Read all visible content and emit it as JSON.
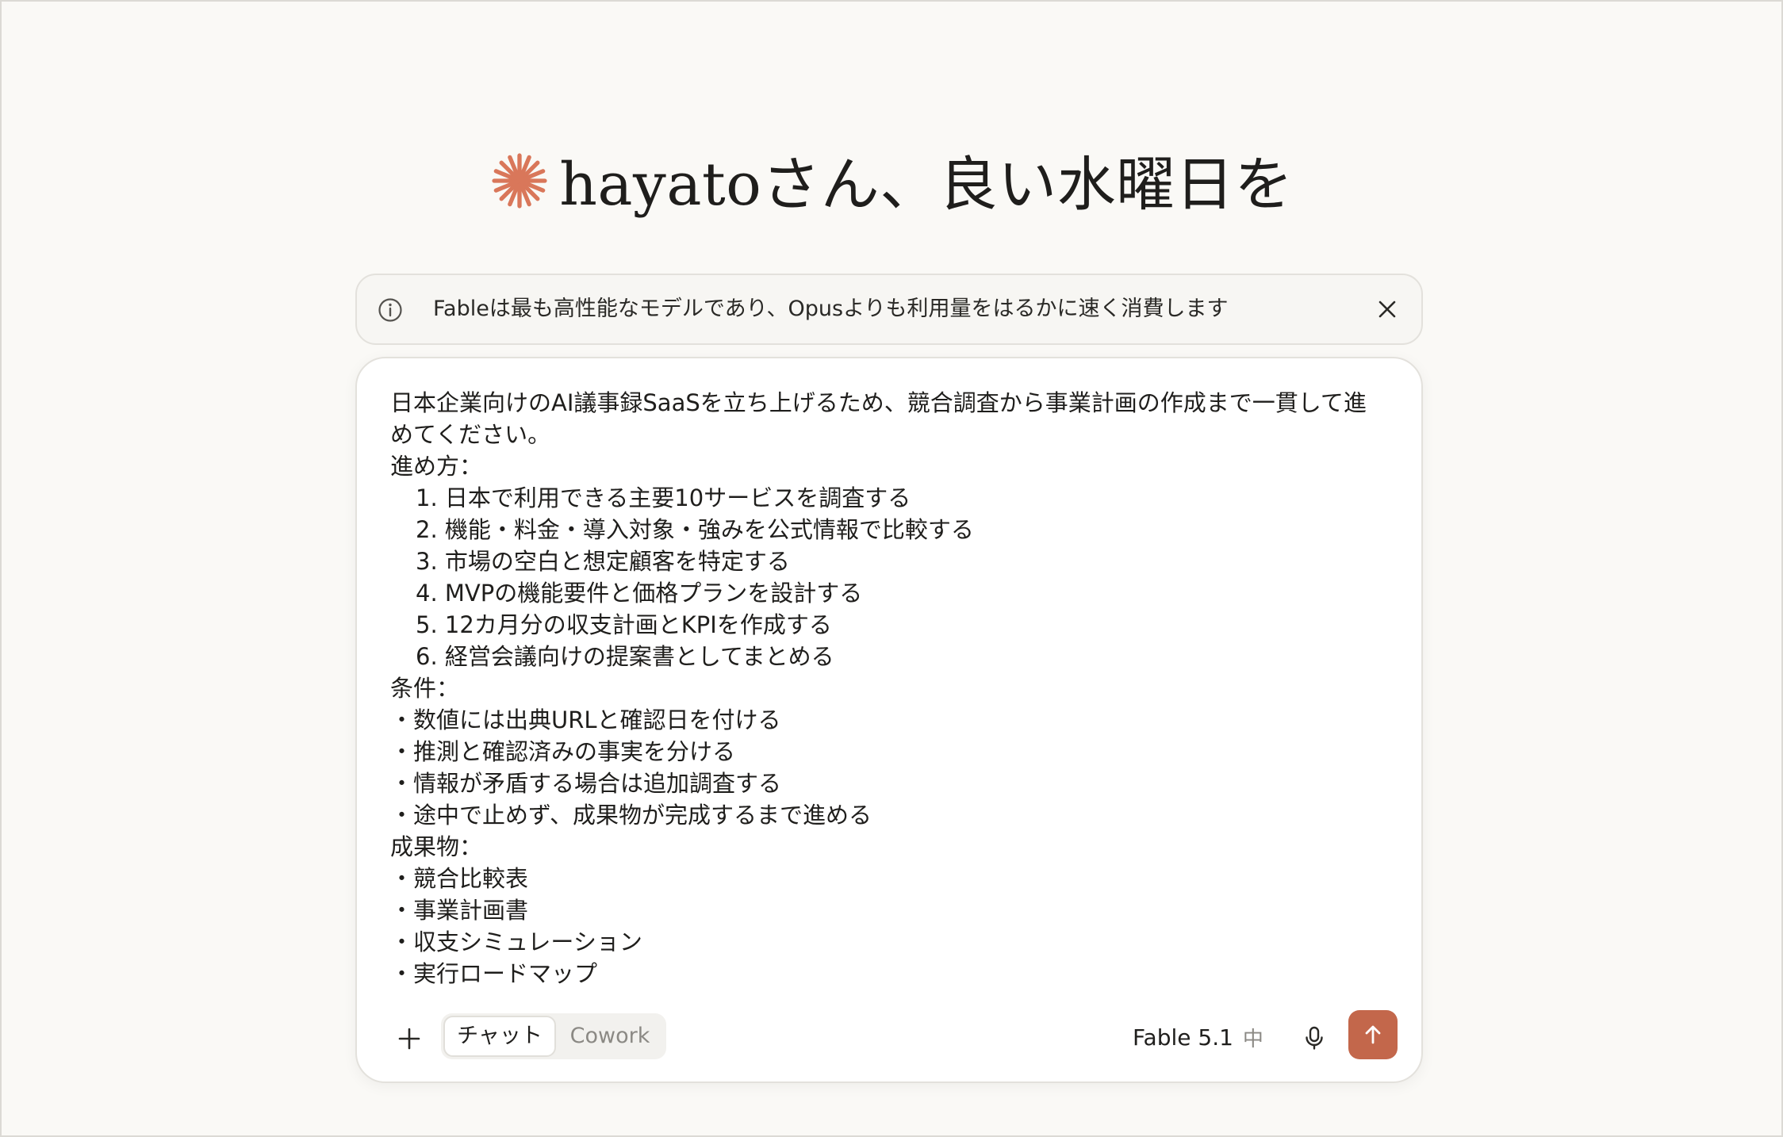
{
  "greeting": {
    "text": "hayatoさん、良い水曜日を",
    "icon": "sparkle-icon",
    "icon_color": "#d9775a"
  },
  "notice": {
    "icon": "info-icon",
    "text": "Fableは最も高性能なモデルであり、Opusよりも利用量をはるかに速く消費します",
    "close_icon": "close-icon"
  },
  "composer": {
    "prompt_lines": [
      "日本企業向けのAI議事録SaaSを立ち上げるため、競合調査から事業計画の作成まで一貫して進",
      "めてください。",
      "進め方：",
      "1. 日本で利用できる主要10サービスを調査する",
      "2. 機能・料金・導入対象・強みを公式情報で比較する",
      "3. 市場の空白と想定顧客を特定する",
      "4. MVPの機能要件と価格プランを設計する",
      "5. 12カ月分の収支計画とKPIを作成する",
      "6. 経営会議向けの提案書としてまとめる",
      "条件：",
      "・数値には出典URLと確認日を付ける",
      "・推測と確認済みの事実を分ける",
      "・情報が矛盾する場合は追加調査する",
      "・途中で止めず、成果物が完成するまで進める",
      "成果物：",
      "・競合比較表",
      "・事業計画書",
      "・収支シミュレーション",
      "・実行ロードマップ"
    ],
    "add_icon": "plus-icon",
    "modes": {
      "chat": "チャット",
      "cowork": "Cowork"
    },
    "model": {
      "name": "Fable 5.1",
      "effort": "中"
    },
    "mic_icon": "microphone-icon",
    "send_icon": "arrow-up-icon",
    "accent_color": "#c3674b"
  }
}
